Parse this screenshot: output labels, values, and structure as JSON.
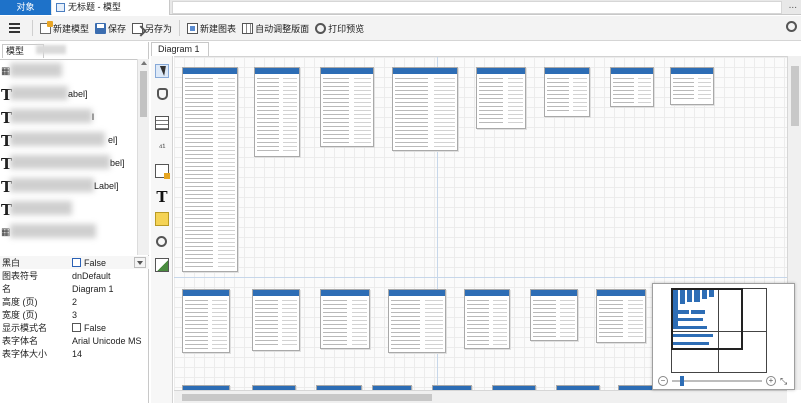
{
  "tabs": {
    "objects_label": "对象",
    "document_label": "无标题 - 模型",
    "more": "..."
  },
  "toolbar": {
    "new_model": "新建模型",
    "save": "保存",
    "save_as": "另存为",
    "new_diagram": "新建图表",
    "auto_layout": "自动调整版面",
    "print_preview": "打印预览"
  },
  "left_panel": {
    "tab_label": "模型",
    "tree_items": [
      {
        "icon": "T",
        "visible_suffix": ""
      },
      {
        "icon": "T",
        "visible_suffix": "abel]"
      },
      {
        "icon": "T",
        "visible_suffix": "l"
      },
      {
        "icon": "T",
        "visible_suffix": "el]"
      },
      {
        "icon": "T",
        "visible_suffix": "bel]"
      },
      {
        "icon": "T",
        "visible_suffix": "Label]"
      },
      {
        "icon": "T",
        "visible_suffix": ""
      }
    ]
  },
  "properties": [
    {
      "key": "黑白",
      "value": "False",
      "checkbox": true
    },
    {
      "key": "图表符号",
      "value": "dnDefault"
    },
    {
      "key": "名",
      "value": "Diagram 1"
    },
    {
      "key": "高度 (页)",
      "value": "2"
    },
    {
      "key": "宽度 (页)",
      "value": "3"
    },
    {
      "key": "显示模式名",
      "value": "False",
      "checkbox": true
    },
    {
      "key": "表字体名",
      "value": "Arial Unicode MS"
    },
    {
      "key": "表字体大小",
      "value": "14"
    }
  ],
  "diagram": {
    "tab_label": "Diagram 1"
  },
  "overview": {
    "zoom_minus": "−",
    "zoom_plus": "+",
    "fit": "⤡"
  }
}
